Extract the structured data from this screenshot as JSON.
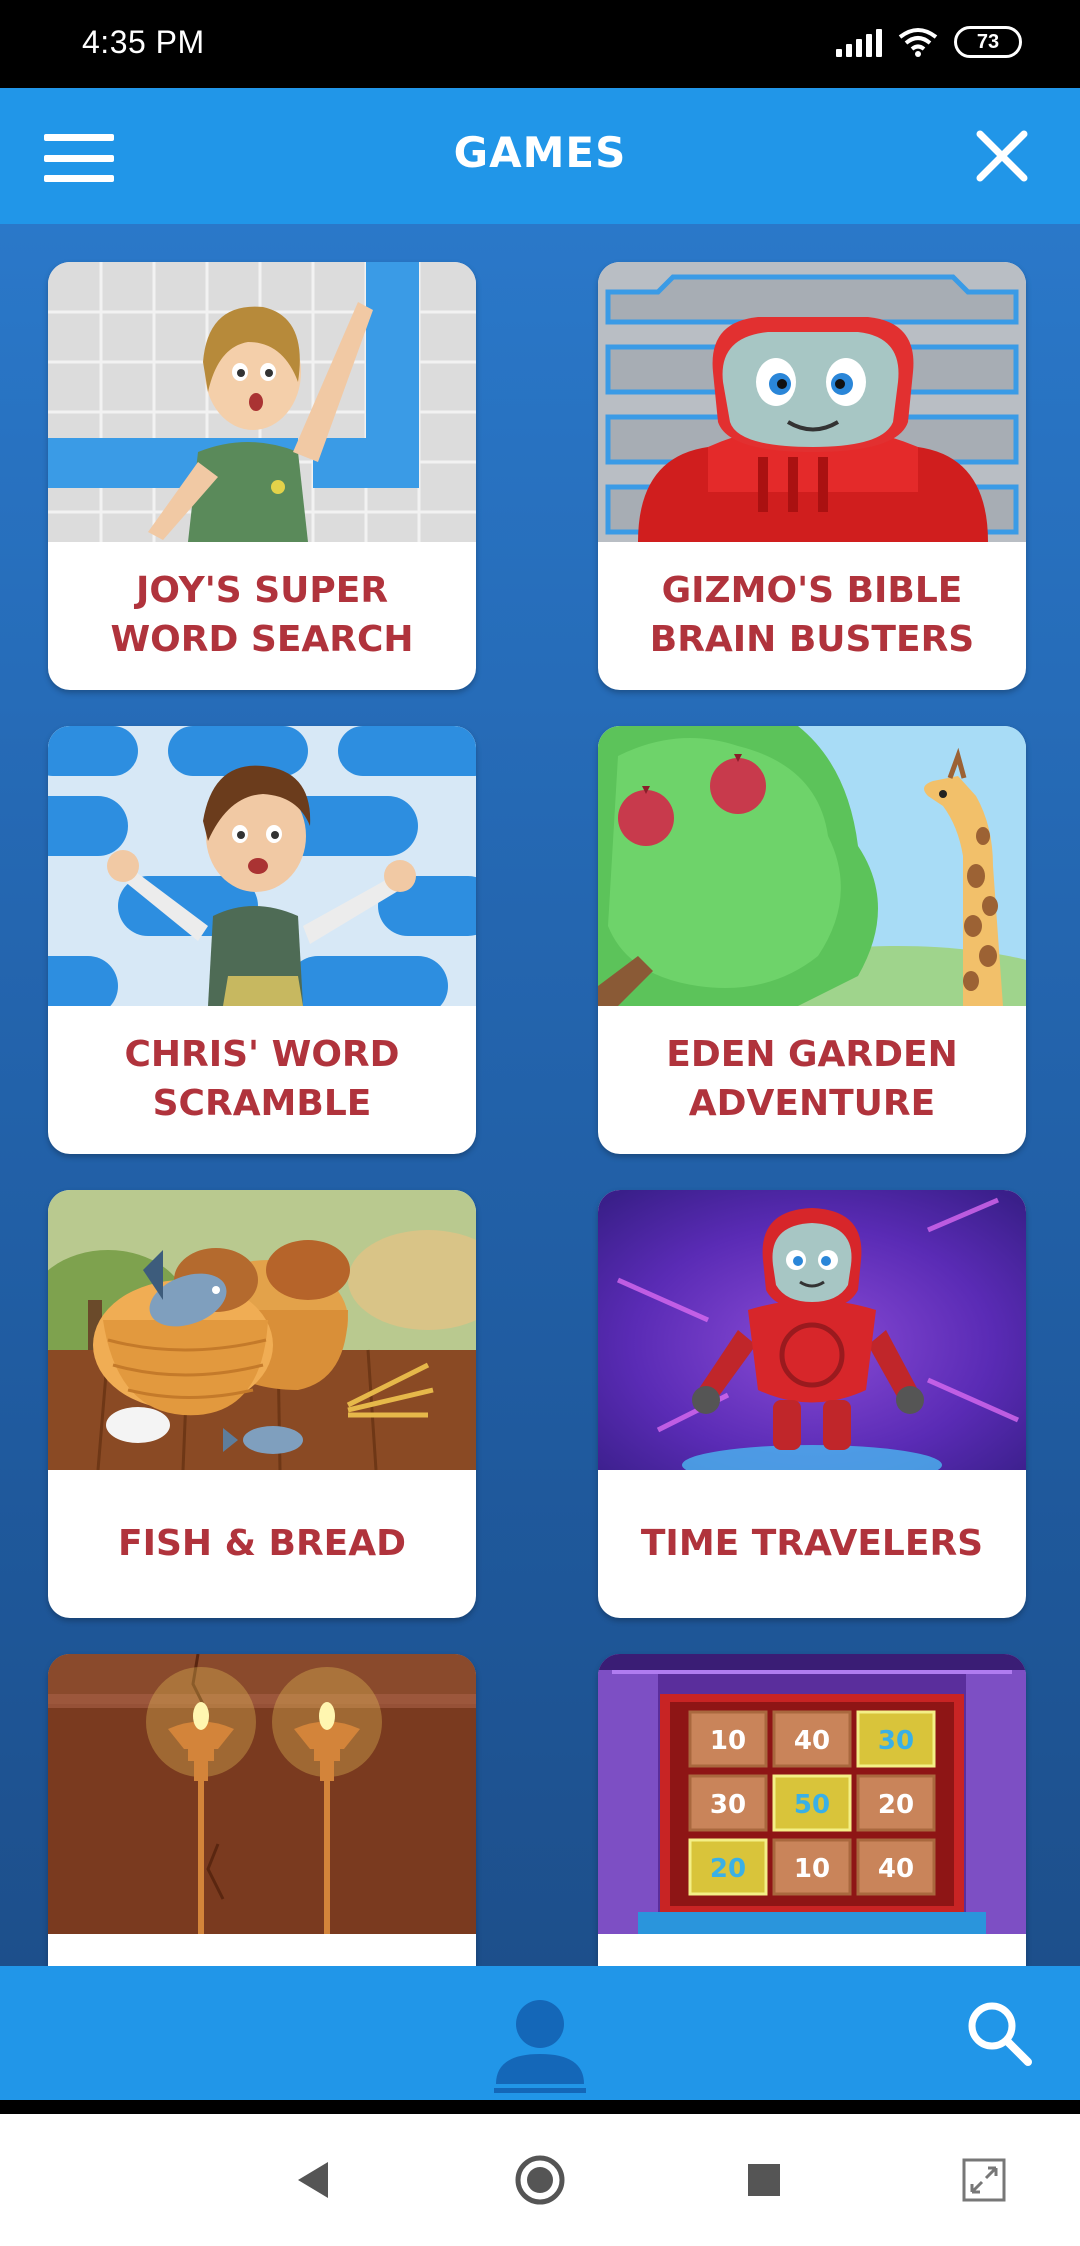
{
  "status_bar": {
    "time": "4:35 PM",
    "battery": "73"
  },
  "header": {
    "title": "GAMES"
  },
  "games": [
    {
      "title": "JOY'S SUPER WORD SEARCH"
    },
    {
      "title": "GIZMO'S BIBLE BRAIN BUSTERS"
    },
    {
      "title": "CHRIS' WORD SCRAMBLE"
    },
    {
      "title": "EDEN GARDEN ADVENTURE"
    },
    {
      "title": "FISH & BREAD"
    },
    {
      "title": "TIME TRAVELERS"
    },
    {
      "title": ""
    },
    {
      "title": ""
    }
  ],
  "quiz_board_values": [
    "10",
    "40",
    "30",
    "30",
    "50",
    "20",
    "20",
    "10",
    "40"
  ],
  "colors": {
    "header_blue": "#2196e8",
    "title_red": "#b0333c",
    "bg_blue": "#2466b0"
  },
  "icons": {
    "menu": "hamburger-icon",
    "close": "close-icon",
    "profile": "person-icon",
    "search": "search-icon"
  }
}
